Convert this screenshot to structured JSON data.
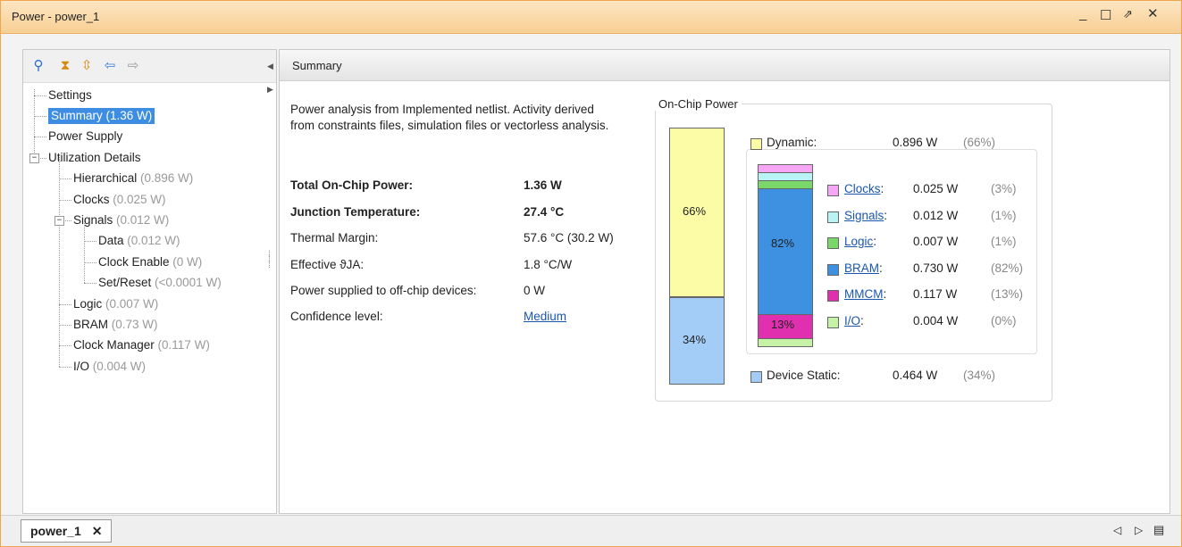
{
  "window": {
    "title": "Power - power_1",
    "controls": [
      "minimize-icon",
      "maximize-icon",
      "restore-icon",
      "close-icon"
    ]
  },
  "toolbar": {
    "icons": [
      "search-icon",
      "collapse-all-icon",
      "expand-all-icon",
      "back-arrow-icon",
      "forward-arrow-icon"
    ]
  },
  "tree": [
    {
      "label": "Settings",
      "value": ""
    },
    {
      "label": "Summary",
      "value": "(1.36 W)"
    },
    {
      "label": "Power Supply",
      "value": ""
    },
    {
      "label": "Utilization Details",
      "value": ""
    },
    {
      "label": "Hierarchical",
      "value": "(0.896 W)"
    },
    {
      "label": "Clocks",
      "value": "(0.025 W)"
    },
    {
      "label": "Signals",
      "value": "(0.012 W)"
    },
    {
      "label": "Data",
      "value": "(0.012 W)"
    },
    {
      "label": "Clock Enable",
      "value": "(0 W)"
    },
    {
      "label": "Set/Reset",
      "value": "(<0.0001 W)"
    },
    {
      "label": "Logic",
      "value": "(0.007 W)"
    },
    {
      "label": "BRAM",
      "value": "(0.73 W)"
    },
    {
      "label": "Clock Manager",
      "value": "(0.117 W)"
    },
    {
      "label": "I/O",
      "value": "(0.004 W)"
    }
  ],
  "summary": {
    "header": "Summary",
    "description": "Power analysis from Implemented netlist. Activity derived from constraints files, simulation files or vectorless analysis.",
    "rows": [
      {
        "label": "Total On-Chip Power:",
        "value": "1.36 W"
      },
      {
        "label": "Junction Temperature:",
        "value": "27.4 °C"
      },
      {
        "label": "Thermal Margin:",
        "value": "57.6 °C (30.2 W)"
      },
      {
        "label": "Effective ϑJA:",
        "value": "1.8 °C/W"
      },
      {
        "label": "Power supplied to off-chip devices:",
        "value": "0 W"
      },
      {
        "label": "Confidence level:",
        "value": "Medium"
      }
    ]
  },
  "chart_data": {
    "type": "bar",
    "title": "On-Chip Power",
    "main": {
      "categories": [
        "Dynamic",
        "Device Static"
      ],
      "values": [
        0.896,
        0.464
      ],
      "percents": [
        "66%",
        "34%"
      ],
      "labels": [
        "Dynamic:",
        "Device Static:"
      ],
      "watts": [
        "0.896 W",
        "0.464 W"
      ],
      "pct_text": [
        "(66%)",
        "(34%)"
      ],
      "colors": [
        "#fcfca6",
        "#a3cdf6"
      ]
    },
    "dynamic": {
      "categories": [
        "Clocks",
        "Signals",
        "Logic",
        "BRAM",
        "MMCM",
        "I/O"
      ],
      "values": [
        0.025,
        0.012,
        0.007,
        0.73,
        0.117,
        0.004
      ],
      "labels": [
        "Clocks:",
        "Signals:",
        "Logic:",
        "BRAM:",
        "MMCM:",
        "I/O:"
      ],
      "watts": [
        "0.025 W",
        "0.012 W",
        "0.007 W",
        "0.730 W",
        "0.117 W",
        "0.004 W"
      ],
      "pct_text": [
        "(3%)",
        "(1%)",
        "(1%)",
        "(82%)",
        "(13%)",
        "(0%)"
      ],
      "bar_labels": [
        "",
        "",
        "",
        "82%",
        "13%",
        ""
      ],
      "colors": [
        "#f6a6f4",
        "#b8f4f6",
        "#7ad86a",
        "#3d91e0",
        "#e030b0",
        "#c6f2a6"
      ]
    }
  },
  "bottom": {
    "tab": "power_1",
    "tab_close": "✕",
    "nav": [
      "◁",
      "▷",
      "▤"
    ]
  }
}
